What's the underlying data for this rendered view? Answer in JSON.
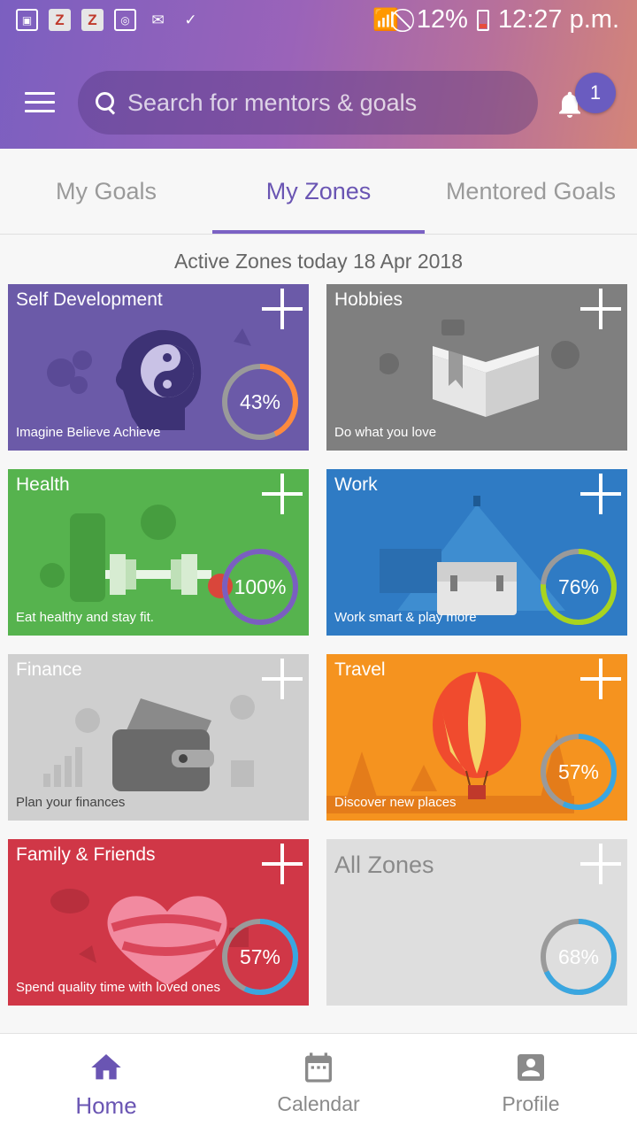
{
  "status": {
    "battery": "12%",
    "time": "12:27 p.m."
  },
  "search": {
    "placeholder": "Search for mentors & goals"
  },
  "notifications": {
    "count": "1"
  },
  "tabs": [
    {
      "label": "My Goals",
      "active": false
    },
    {
      "label": "My Zones",
      "active": true
    },
    {
      "label": "Mentored Goals",
      "active": false
    }
  ],
  "subtitle": "Active Zones today 18 Apr 2018",
  "zones": [
    {
      "title": "Self Development",
      "tagline": "Imagine Believe Achieve",
      "progress": "43%",
      "progress_value": 0.43,
      "color": "#6b5aa8",
      "ring_color": "#ff8a3d"
    },
    {
      "title": "Hobbies",
      "tagline": "Do what you love",
      "progress": "",
      "color": "#7f7f7f"
    },
    {
      "title": "Health",
      "tagline": "Eat healthy and stay fit.",
      "progress": "100%",
      "progress_value": 1.0,
      "color": "#56b34e",
      "ring_color": "#7a5fc0"
    },
    {
      "title": "Work",
      "tagline": "Work smart & play more",
      "progress": "76%",
      "progress_value": 0.76,
      "color": "#2f7bc4",
      "ring_color": "#a8d41f"
    },
    {
      "title": "Finance",
      "tagline": "Plan your finances",
      "progress": "",
      "color": "#cfcfcf"
    },
    {
      "title": "Travel",
      "tagline": "Discover new places",
      "progress": "57%",
      "progress_value": 0.57,
      "color": "#f5931f",
      "ring_color": "#3aa6e0"
    },
    {
      "title": "Family & Friends",
      "tagline": "Spend quality time with loved ones",
      "progress": "57%",
      "progress_value": 0.57,
      "color": "#d03747",
      "ring_color": "#3aa6e0"
    },
    {
      "title": "All Zones",
      "tagline": "",
      "progress": "68%",
      "progress_value": 0.68,
      "color": "#dedede",
      "ring_color": "#3aa6e0"
    }
  ],
  "nav": [
    {
      "label": "Home",
      "icon": "home-icon",
      "active": true
    },
    {
      "label": "Calendar",
      "icon": "calendar-icon",
      "active": false
    },
    {
      "label": "Profile",
      "icon": "profile-icon",
      "active": false
    }
  ]
}
